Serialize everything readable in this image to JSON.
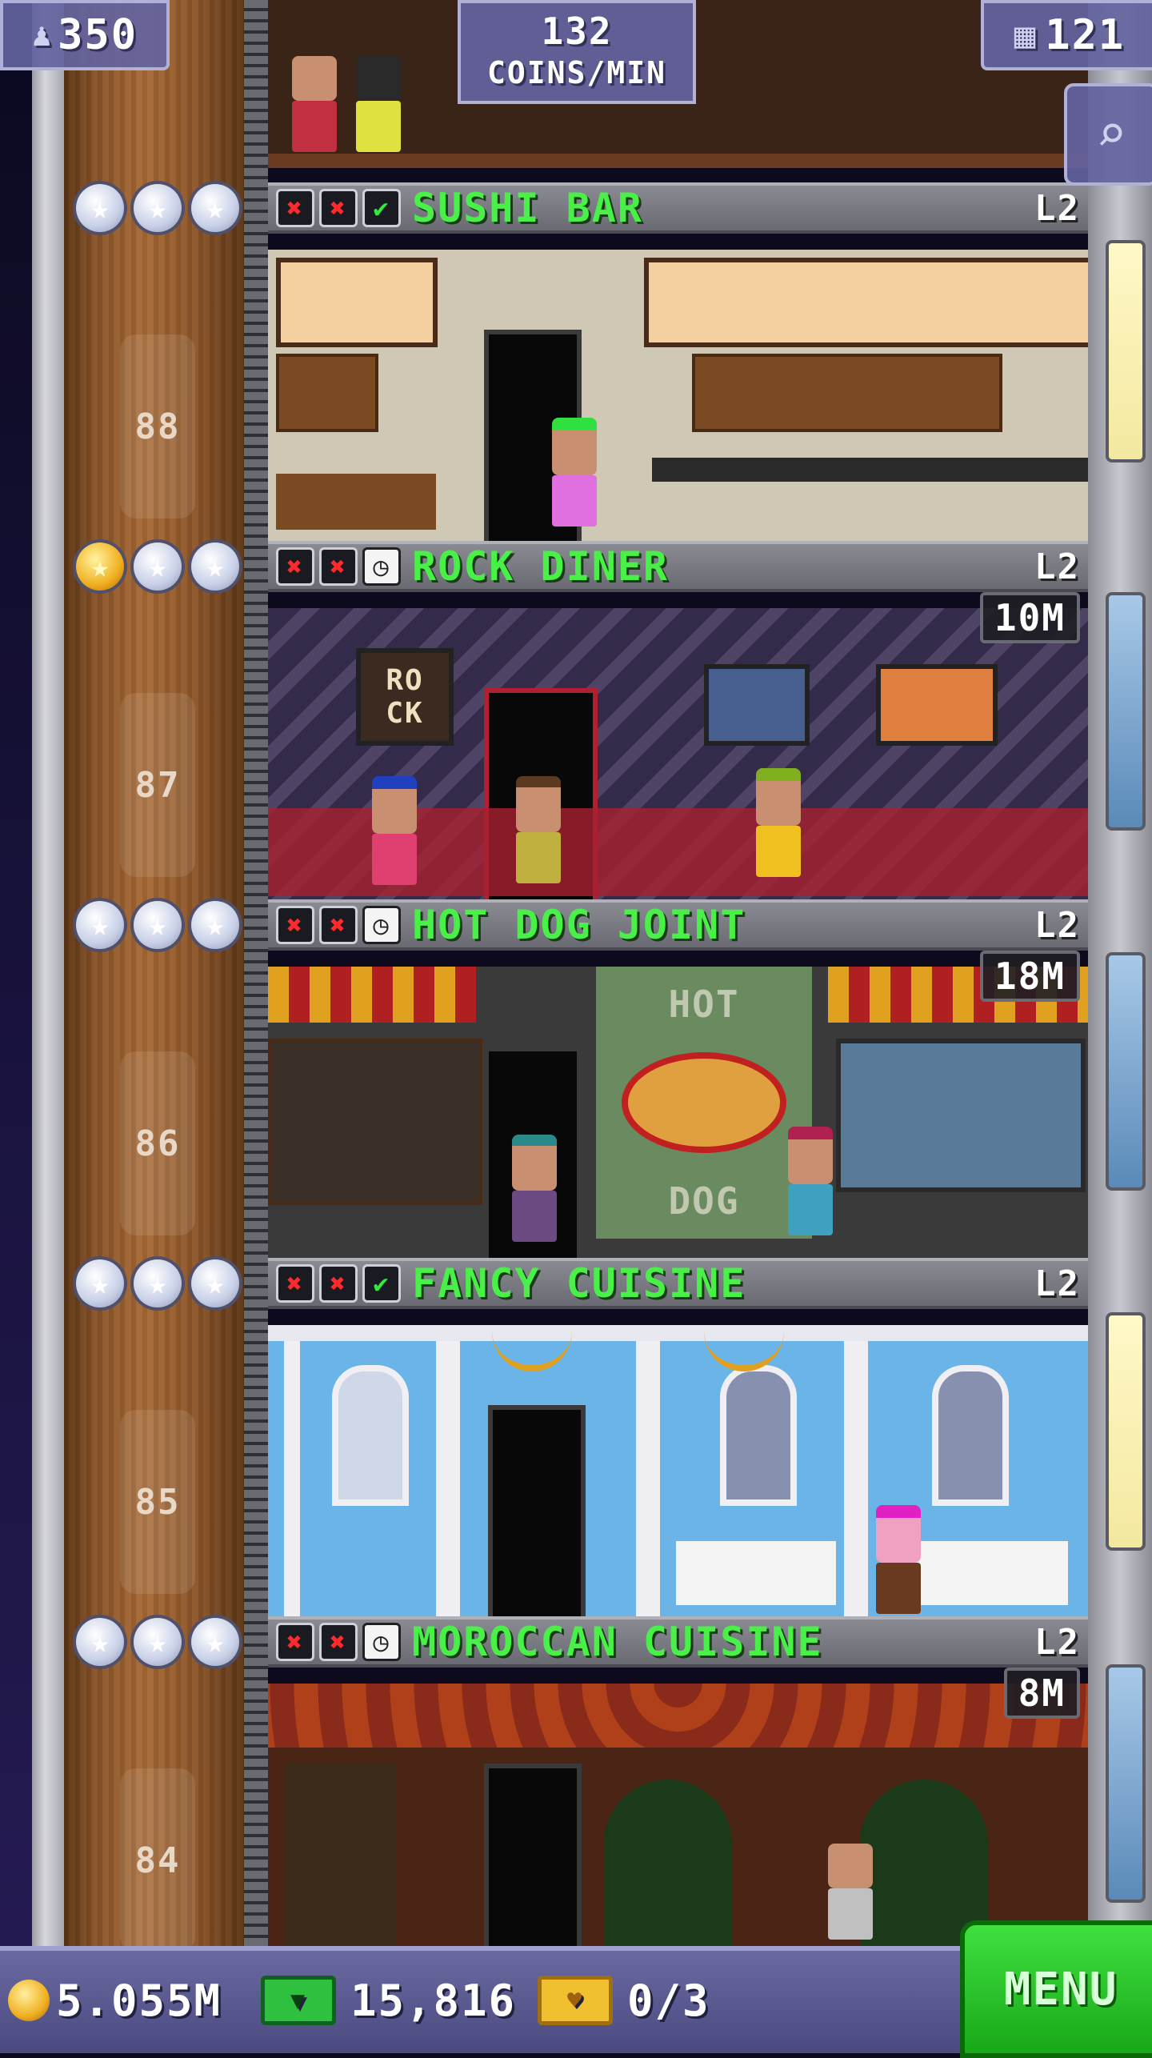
{
  "hud": {
    "population": "350",
    "coins_rate_value": "132",
    "coins_rate_unit": "COINS/MIN",
    "floor_count": "121",
    "person_icon": "person-icon",
    "building_icon": "building-icon",
    "zoom_icon": "magnifier-icon"
  },
  "floors": [
    {
      "number": "88",
      "name": "SUSHI BAR",
      "level": "L2",
      "timer": "",
      "badges": [
        "x",
        "x",
        "check"
      ],
      "stars_gold": 0
    },
    {
      "number": "87",
      "name": "ROCK DINER",
      "level": "L2",
      "timer": "10M",
      "badges": [
        "x",
        "x",
        "clock"
      ],
      "stars_gold": 1
    },
    {
      "number": "86",
      "name": "HOT DOG JOINT",
      "level": "L2",
      "timer": "18M",
      "badges": [
        "x",
        "x",
        "clock"
      ],
      "stars_gold": 0
    },
    {
      "number": "85",
      "name": "FANCY CUISINE",
      "level": "L2",
      "timer": "",
      "badges": [
        "x",
        "x",
        "check"
      ],
      "stars_gold": 0
    },
    {
      "number": "84",
      "name": "MOROCCAN CUISINE",
      "level": "L2",
      "timer": "8M",
      "badges": [
        "x",
        "x",
        "clock"
      ],
      "stars_gold": 0
    }
  ],
  "hotdog_sign": {
    "top": "HOT",
    "bottom": "DOG"
  },
  "rock_sign": {
    "line1": "RO",
    "line2": "CK"
  },
  "bottom": {
    "coins": "5.055M",
    "bux": "15,816",
    "tickets": "0/3",
    "menu_label": "MENU"
  },
  "colors": {
    "name_green": "#48f048",
    "menu_green": "#30d030",
    "hud_purple": "#6464a0"
  }
}
